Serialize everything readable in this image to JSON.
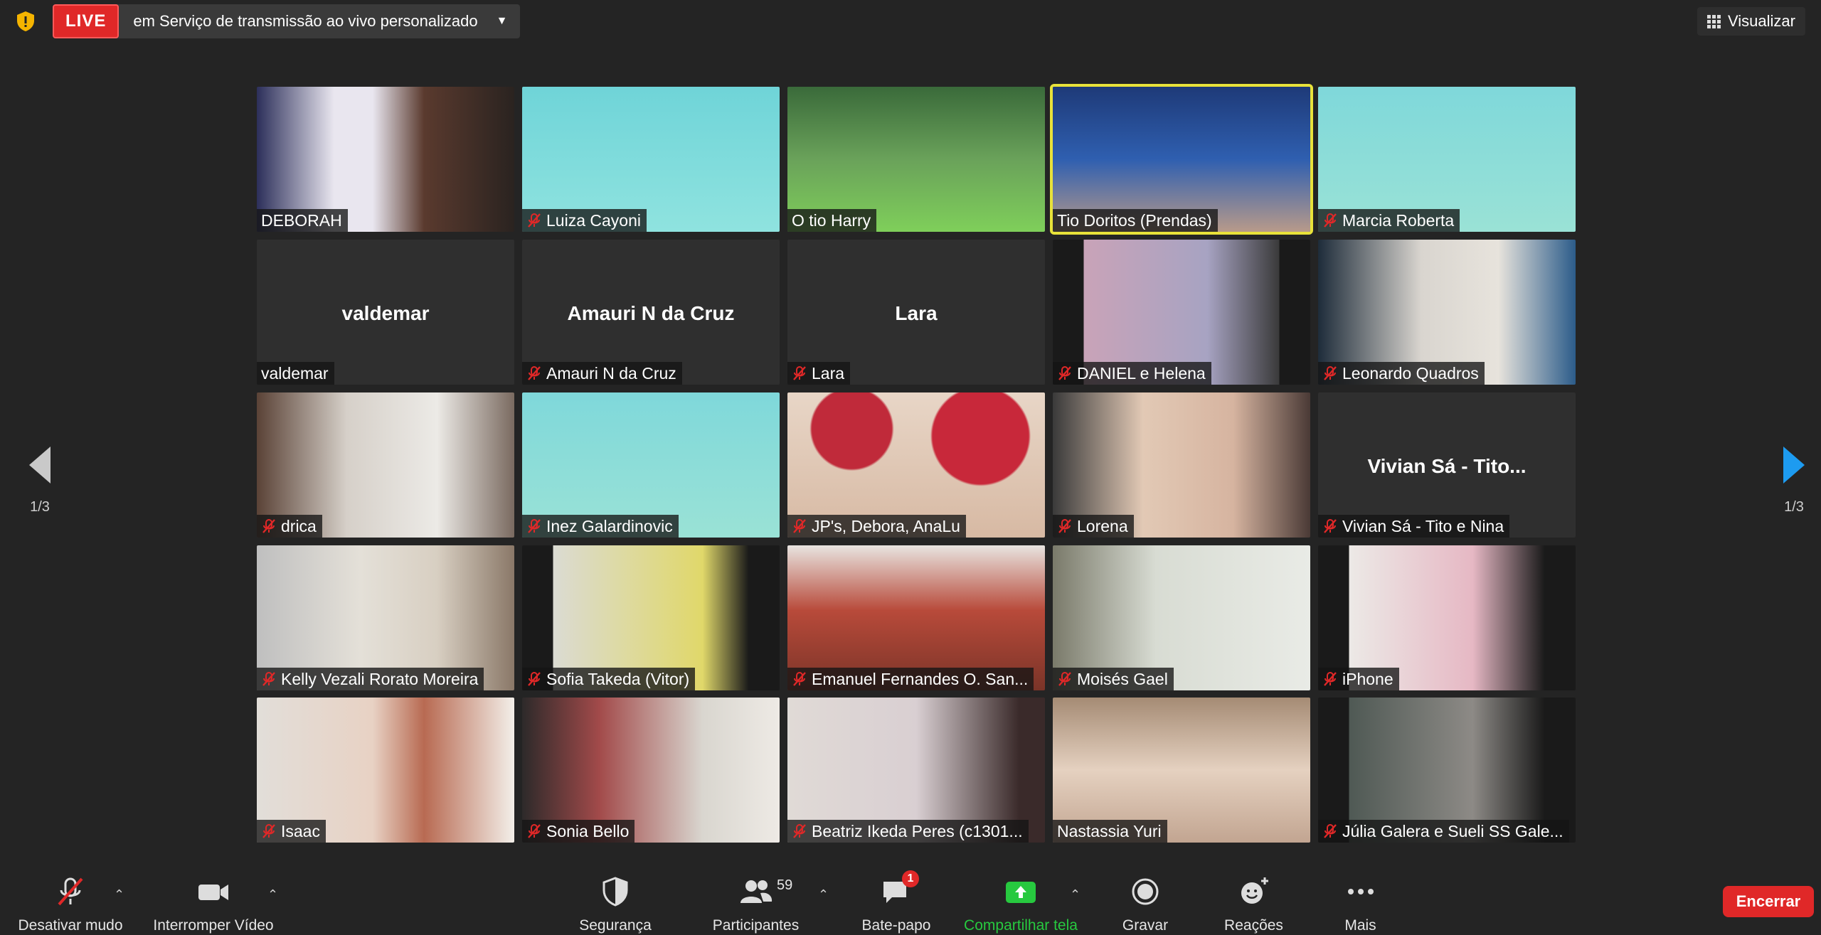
{
  "topbar": {
    "live_badge": "LIVE",
    "stream_text": "em Serviço de transmissão ao vivo personalizado",
    "view_label": "Visualizar"
  },
  "pagination": {
    "left_page": "1/3",
    "right_page": "1/3"
  },
  "participants": [
    {
      "name": "DEBORAH",
      "muted": false,
      "video": true
    },
    {
      "name": "Luiza Cayoni",
      "muted": true,
      "video": true
    },
    {
      "name": "O tio Harry",
      "muted": false,
      "video": true
    },
    {
      "name": "Tio Doritos (Prendas)",
      "muted": false,
      "video": true,
      "active_speaker": true
    },
    {
      "name": "Marcia Roberta",
      "muted": true,
      "video": true
    },
    {
      "name": "valdemar",
      "muted": false,
      "video": false,
      "display_name": "valdemar"
    },
    {
      "name": "Amauri N da Cruz",
      "muted": true,
      "video": false,
      "display_name": "Amauri N da Cruz"
    },
    {
      "name": "Lara",
      "muted": true,
      "video": false,
      "display_name": "Lara"
    },
    {
      "name": "DANIEL e Helena",
      "muted": true,
      "video": true
    },
    {
      "name": "Leonardo Quadros",
      "muted": true,
      "video": true
    },
    {
      "name": "drica",
      "muted": true,
      "video": true
    },
    {
      "name": "Inez Galardinovic",
      "muted": true,
      "video": true
    },
    {
      "name": "JP's, Debora, AnaLu",
      "muted": true,
      "video": true
    },
    {
      "name": "Lorena",
      "muted": true,
      "video": true
    },
    {
      "name": "Vivian Sá - Tito e Nina",
      "muted": true,
      "video": false,
      "display_name": "Vivian Sá - Tito..."
    },
    {
      "name": "Kelly Vezali Rorato Moreira",
      "muted": true,
      "video": true
    },
    {
      "name": "Sofia Takeda (Vitor)",
      "muted": true,
      "video": true
    },
    {
      "name": "Emanuel Fernandes O. San...",
      "muted": true,
      "video": true
    },
    {
      "name": "Moisés Gael",
      "muted": true,
      "video": true
    },
    {
      "name": "iPhone",
      "muted": true,
      "video": true
    },
    {
      "name": "Isaac",
      "muted": true,
      "video": true
    },
    {
      "name": "Sonia Bello",
      "muted": true,
      "video": true
    },
    {
      "name": "Beatriz Ikeda Peres (c1301...",
      "muted": true,
      "video": true
    },
    {
      "name": "Nastassia Yuri",
      "muted": false,
      "video": true
    },
    {
      "name": "Júlia Galera e Sueli SS Gale...",
      "muted": true,
      "video": true
    }
  ],
  "toolbar": {
    "mute_label": "Desativar mudo",
    "video_label": "Interromper Vídeo",
    "security_label": "Segurança",
    "participants_label": "Participantes",
    "participants_count": "59",
    "chat_label": "Bate-papo",
    "chat_badge": "1",
    "share_label": "Compartilhar tela",
    "record_label": "Gravar",
    "reactions_label": "Reações",
    "more_label": "Mais",
    "end_label": "Encerrar"
  },
  "colors": {
    "background": "#242424",
    "live_red": "#e02828",
    "active_speaker": "#e8e23a",
    "share_green": "#27c93f",
    "page_arrow_blue": "#1d9bf0"
  }
}
